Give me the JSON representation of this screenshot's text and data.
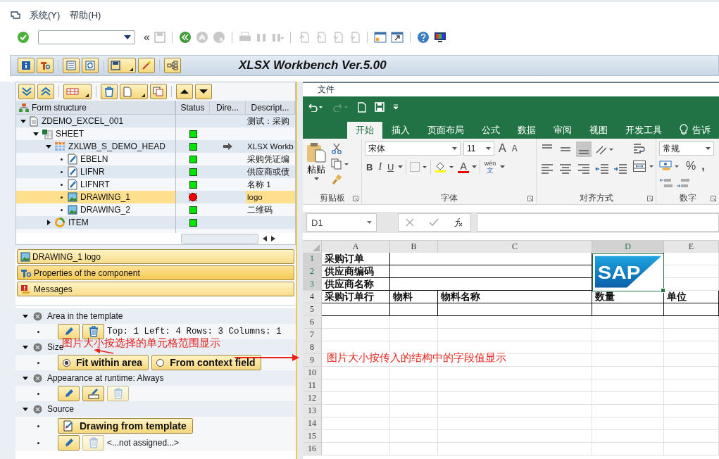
{
  "menu": [
    {
      "label": "系统(Y)"
    },
    {
      "label": "帮助(H)"
    }
  ],
  "toolbar": {
    "history_glyph": "«"
  },
  "app_title": "XLSX Workbench Ver.5.00",
  "tree": {
    "columns": [
      "Form structure",
      "Status",
      "Dire...",
      "Descript..."
    ],
    "nodes": [
      {
        "name": "ZDEMO_EXCEL_001",
        "kind": "form",
        "direction_arrow": false,
        "description": "测试：采购",
        "expanded": true,
        "selected": false,
        "children": [
          {
            "name": "SHEET",
            "kind": "sheet",
            "status_error": false,
            "direction_arrow": false,
            "expanded": true,
            "selected": false,
            "children": [
              {
                "name": "ZXLWB_S_DEMO_HEAD",
                "kind": "structure",
                "status_error": false,
                "direction_arrow": true,
                "description": "XLSX Workb",
                "expanded": true,
                "selected": false,
                "children": [
                  {
                    "name": "EBELN",
                    "kind": "field",
                    "status_error": false,
                    "direction_arrow": false,
                    "description": "采购凭证编",
                    "selected": false
                  },
                  {
                    "name": "LIFNR",
                    "kind": "field",
                    "status_error": false,
                    "direction_arrow": false,
                    "description": "供应商或债",
                    "selected": false
                  },
                  {
                    "name": "LIFNRT",
                    "kind": "field",
                    "status_error": false,
                    "direction_arrow": false,
                    "description": "名称 1",
                    "selected": false
                  },
                  {
                    "name": "DRAWING_1",
                    "kind": "drawing",
                    "status_error": true,
                    "direction_arrow": false,
                    "description": "logo",
                    "selected": true
                  },
                  {
                    "name": "DRAWING_2",
                    "kind": "drawing",
                    "status_error": false,
                    "direction_arrow": false,
                    "description": "二维码",
                    "selected": false
                  }
                ]
              },
              {
                "name": "ITEM",
                "kind": "loop",
                "status_error": false,
                "direction_arrow": false,
                "expanded": false,
                "selected": false
              }
            ]
          }
        ]
      }
    ]
  },
  "panels": [
    {
      "label": "DRAWING_1  logo",
      "kind": "drawing",
      "selected": false
    },
    {
      "label": "Properties of the component",
      "kind": "properties",
      "selected": true
    },
    {
      "label": "Messages",
      "kind": "messages",
      "selected": false
    }
  ],
  "sections": [
    {
      "title": "Area in the template",
      "expanded": true,
      "rows": [
        {
          "buttons": [
            {
              "kind": "pencil",
              "disabled": false
            },
            {
              "kind": "trash",
              "disabled": false
            }
          ],
          "text": "Top: 1 Left: 4 Rows: 3 Columns: 1"
        }
      ]
    },
    {
      "title": "Size",
      "expanded": true,
      "rows": [
        {
          "radios": [
            {
              "label": "Fit within area",
              "selected": true
            },
            {
              "label": "From context field",
              "selected": false
            }
          ]
        }
      ]
    },
    {
      "title": "Appearance at runtime: Always",
      "expanded": true,
      "rows": [
        {
          "buttons": [
            {
              "kind": "pencil",
              "disabled": false
            },
            {
              "kind": "edit-list",
              "disabled": false
            },
            {
              "kind": "trash",
              "disabled": true
            }
          ]
        }
      ]
    },
    {
      "title": "Source",
      "expanded": true,
      "rows": [
        {
          "buttons": [
            {
              "kind": "document",
              "label": "Drawing from template",
              "disabled": false
            }
          ]
        },
        {
          "buttons": [
            {
              "kind": "pencil",
              "disabled": false
            },
            {
              "kind": "trash",
              "disabled": true
            }
          ],
          "text": "<...not assigned...>"
        }
      ]
    }
  ],
  "annotations": [
    {
      "text": "图片大小按选择的单元格范围显示"
    },
    {
      "text": "图片大小按传入的结构中的字段值显示"
    }
  ],
  "excel": {
    "menu": [
      "文件"
    ],
    "tabs": [
      {
        "label": "开始",
        "selected": true
      },
      {
        "label": "插入",
        "selected": false
      },
      {
        "label": "页面布局",
        "selected": false
      },
      {
        "label": "公式",
        "selected": false
      },
      {
        "label": "数据",
        "selected": false
      },
      {
        "label": "审阅",
        "selected": false
      },
      {
        "label": "视图",
        "selected": false
      },
      {
        "label": "开发工具",
        "selected": false
      }
    ],
    "tell_me": "告诉",
    "paste_label": "粘贴",
    "font_name": "宋体",
    "font_size": "11",
    "grow_glyph": "A",
    "shrink_glyph": "A",
    "bold_glyph": "B",
    "italic_glyph": "I",
    "underline_glyph": "U",
    "font_color_glyph": "A",
    "phonetic": [
      "wén",
      "文"
    ],
    "number_format": "常规",
    "percent_glyph": "%",
    "comma_glyph": ",",
    "groups": [
      "剪贴板",
      "字体",
      "对齐方式",
      "数字"
    ],
    "name_box": "D1",
    "columns": [
      {
        "label": "A",
        "selected": false
      },
      {
        "label": "B",
        "selected": false
      },
      {
        "label": "C",
        "selected": false
      },
      {
        "label": "D",
        "selected": true
      },
      {
        "label": "E",
        "selected": false
      }
    ],
    "rows": [
      {
        "label": "1",
        "selected": true
      },
      {
        "label": "2",
        "selected": true
      },
      {
        "label": "3",
        "selected": true
      },
      {
        "label": "4",
        "selected": false
      },
      {
        "label": "5",
        "selected": false
      },
      {
        "label": "6",
        "selected": false
      },
      {
        "label": "7",
        "selected": false
      },
      {
        "label": "8",
        "selected": false
      },
      {
        "label": "9",
        "selected": false
      },
      {
        "label": "10",
        "selected": false
      },
      {
        "label": "11",
        "selected": false
      },
      {
        "label": "12",
        "selected": false
      },
      {
        "label": "13",
        "selected": false
      },
      {
        "label": "14",
        "selected": false
      },
      {
        "label": "15",
        "selected": false
      },
      {
        "label": "16",
        "selected": false
      }
    ],
    "header_block": [
      "采购订单",
      "供应商编码",
      "供应商名称"
    ],
    "table_header": [
      "采购订单行",
      "物料",
      "物料名称",
      "数量",
      "单位"
    ],
    "logo": {
      "text": "SAP"
    }
  }
}
